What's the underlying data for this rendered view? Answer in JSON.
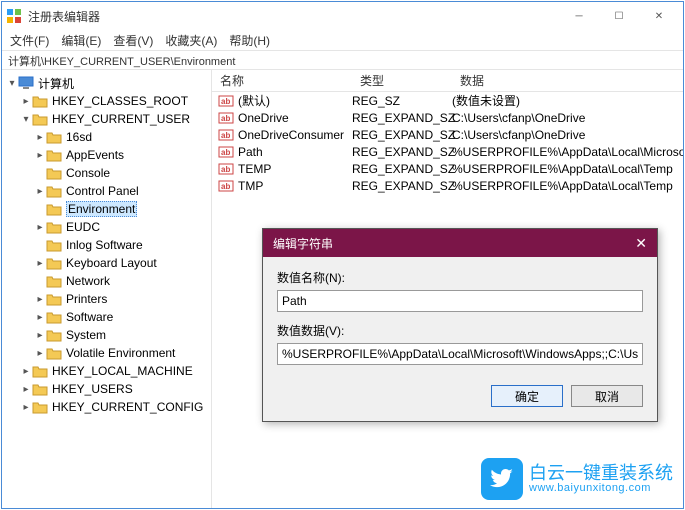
{
  "window": {
    "title": "注册表编辑器",
    "menu": {
      "file": "文件(F)",
      "edit": "编辑(E)",
      "view": "查看(V)",
      "favorites": "收藏夹(A)",
      "help": "帮助(H)"
    },
    "address": "计算机\\HKEY_CURRENT_USER\\Environment"
  },
  "tree": {
    "root": "计算机",
    "hkcr": "HKEY_CLASSES_ROOT",
    "hkcu": "HKEY_CURRENT_USER",
    "hkcu_children": {
      "c0": "16sd",
      "c1": "AppEvents",
      "c2": "Console",
      "c3": "Control Panel",
      "c4": "Environment",
      "c5": "EUDC",
      "c6": "Inlog Software",
      "c7": "Keyboard Layout",
      "c8": "Network",
      "c9": "Printers",
      "c10": "Software",
      "c11": "System",
      "c12": "Volatile Environment"
    },
    "hklm": "HKEY_LOCAL_MACHINE",
    "hku": "HKEY_USERS",
    "hkcc": "HKEY_CURRENT_CONFIG"
  },
  "list": {
    "headers": {
      "name": "名称",
      "type": "类型",
      "data": "数据"
    },
    "rows": [
      {
        "name": "(默认)",
        "type": "REG_SZ",
        "data": "(数值未设置)"
      },
      {
        "name": "OneDrive",
        "type": "REG_EXPAND_SZ",
        "data": "C:\\Users\\cfanp\\OneDrive"
      },
      {
        "name": "OneDriveConsumer",
        "type": "REG_EXPAND_SZ",
        "data": "C:\\Users\\cfanp\\OneDrive"
      },
      {
        "name": "Path",
        "type": "REG_EXPAND_SZ",
        "data": "%USERPROFILE%\\AppData\\Local\\Microsoft\\..."
      },
      {
        "name": "TEMP",
        "type": "REG_EXPAND_SZ",
        "data": "%USERPROFILE%\\AppData\\Local\\Temp"
      },
      {
        "name": "TMP",
        "type": "REG_EXPAND_SZ",
        "data": "%USERPROFILE%\\AppData\\Local\\Temp"
      }
    ]
  },
  "dialog": {
    "title": "编辑字符串",
    "name_label": "数值名称(N):",
    "name_value": "Path",
    "data_label": "数值数据(V):",
    "data_value": "%USERPROFILE%\\AppData\\Local\\Microsoft\\WindowsApps;;C:\\Users\\cf",
    "ok": "确定",
    "cancel": "取消"
  },
  "watermark": {
    "brand": "白云一键重装系统",
    "url": "www.baiyunxitong.com"
  }
}
